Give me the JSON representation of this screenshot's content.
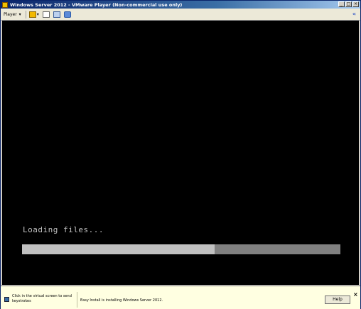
{
  "window": {
    "title": "Windows Server 2012 - VMware Player (Non-commercial use only)",
    "controls": {
      "minimize": "_",
      "maximize": "□",
      "close": "×"
    }
  },
  "toolbar": {
    "player_menu": "Player",
    "player_arrow": "▾",
    "pause_dropdown": "▾",
    "collapse": "«",
    "icons": [
      "pause-icon",
      "network-adapter-icon",
      "full-screen-icon",
      "unity-icon"
    ]
  },
  "screen": {
    "loading_text": "Loading files...",
    "progress": 0.605
  },
  "status": {
    "hint": "Click in the virtual screen to send keystrokes",
    "install_message": "Easy Install is installing Windows Server 2012.",
    "help_label": "Help",
    "close": "×"
  },
  "colors": {
    "titlebar": "#0a246a",
    "screen_bg": "#000000",
    "progress_fill": "#c0c0c0",
    "progress_track": "#808080",
    "status_bg": "#ffffe1"
  }
}
